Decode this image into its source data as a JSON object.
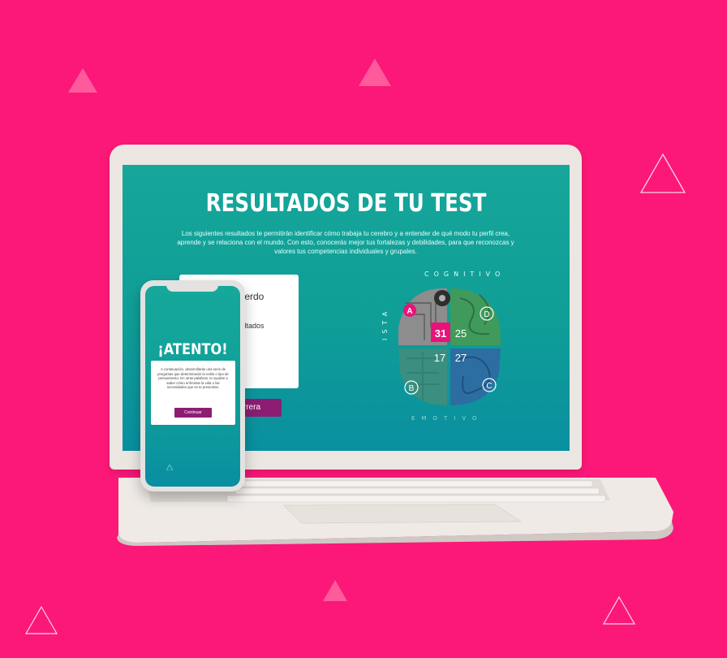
{
  "colors": {
    "background": "#fb1878",
    "screen_teal": "#12a39a",
    "button_purple": "#8c1d73",
    "badge_pink": "#e8137a"
  },
  "laptop_screen": {
    "title": "RESULTADOS DE TU TEST",
    "intro": "Los siguientes resultados te permitirán identificar cómo trabaja tu cerebro y a entender de qué modo tu perfil crea, aprende y se relaciona con el mundo. Con esto, conocerás mejor tus fortalezas y debilidades, para que reconozcas y valores tus competencias individuales y grupales.",
    "card_line1": "uierdo",
    "card_line2": "sultados",
    "career_button": "u carrera",
    "brain": {
      "top_label": "COGNITIVO",
      "left_label": "ISTA",
      "bottom_label": "EMOTIVO",
      "quadrants": [
        {
          "letter": "A",
          "score": "31"
        },
        {
          "letter": "D",
          "score": "25"
        },
        {
          "letter": "B",
          "score": "17"
        },
        {
          "letter": "C",
          "score": "27"
        }
      ]
    }
  },
  "phone_screen": {
    "title": "¡ATENTO!",
    "message": "A continuación, desarrollarás una serie de preguntas que determinarán tu estilo o tipo de pensamiento. En otras palabras, te ayudan a saber cómo enfrentas la vida o las necesidades que se te presentan.",
    "continue_button": "Continuar"
  }
}
